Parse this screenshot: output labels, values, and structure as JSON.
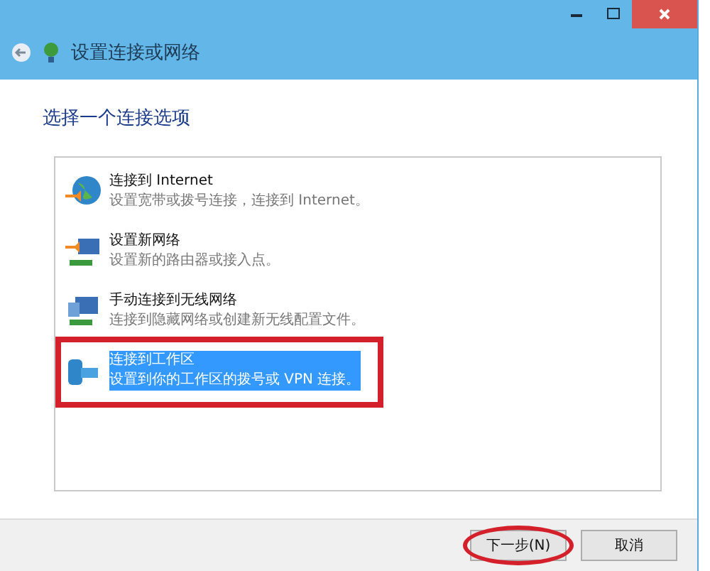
{
  "window": {
    "title": "设置连接或网络"
  },
  "heading": "选择一个连接选项",
  "options": [
    {
      "kind": "internet",
      "title": "连接到 Internet",
      "description": "设置宽带或拨号连接，连接到 Internet。",
      "selected": false,
      "marked": false
    },
    {
      "kind": "new-network",
      "title": "设置新网络",
      "description": "设置新的路由器或接入点。",
      "selected": false,
      "marked": false
    },
    {
      "kind": "wireless",
      "title": "手动连接到无线网络",
      "description": "连接到隐藏网络或创建新无线配置文件。",
      "selected": false,
      "marked": false
    },
    {
      "kind": "workplace",
      "title": "连接到工作区",
      "description": "设置到你的工作区的拨号或 VPN 连接。",
      "selected": true,
      "marked": true
    }
  ],
  "buttons": [
    {
      "label": "下一步(N)",
      "marked": true
    },
    {
      "label": "取消",
      "marked": false
    }
  ]
}
